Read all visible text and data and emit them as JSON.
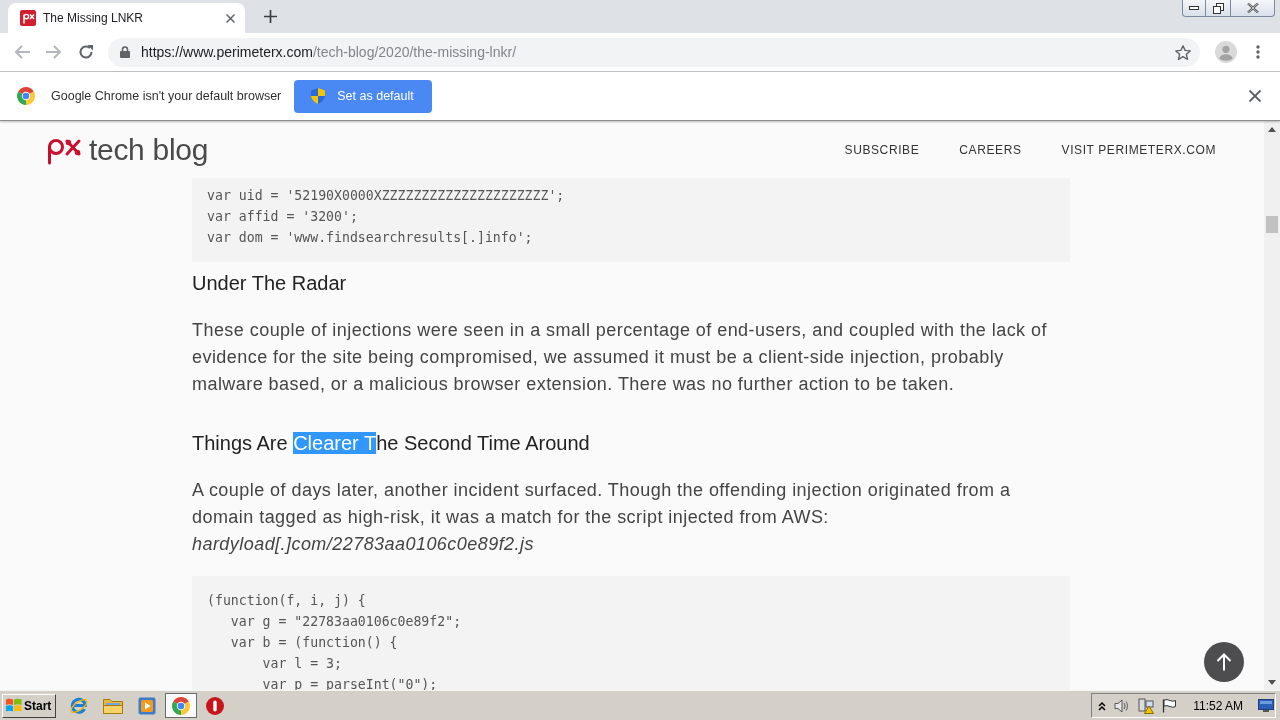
{
  "browser": {
    "tabs": [
      {
        "title": "The Missing LNKR",
        "selected": true
      }
    ],
    "address": {
      "host": "https://www.perimeterx.com",
      "path": "/tech-blog/2020/the-missing-lnkr/"
    }
  },
  "infobar": {
    "message": "Google Chrome isn't your default browser",
    "button": "Set as default"
  },
  "site": {
    "logo_text": "tech blog",
    "nav": [
      "SUBSCRIBE",
      "CAREERS",
      "VISIT PERIMETERX.COM"
    ]
  },
  "article": [
    {
      "kind": "code",
      "lines": [
        "var uid = '52190X0000XZZZZZZZZZZZZZZZZZZZZZ';",
        "var affid = '3200';",
        "var dom = 'www.findsearchresults[.]info';"
      ]
    },
    {
      "kind": "heading",
      "segments": [
        {
          "text": "Under The Radar",
          "selected": false
        }
      ]
    },
    {
      "kind": "paragraph",
      "text": "These couple of injections were seen in a small percentage of end-users, and coupled with the lack of evidence for the site being compromised, we assumed it must be a client-side injection, probably malware based, or a malicious browser extension. There was no further action to be taken."
    },
    {
      "kind": "heading",
      "segments": [
        {
          "text": "Things Are ",
          "selected": false
        },
        {
          "text": "Clearer T",
          "selected": true
        },
        {
          "text": "he Second Time Around",
          "selected": false
        }
      ]
    },
    {
      "kind": "paragraph",
      "text": "A couple of days later, another incident surfaced. Though the offending injection originated from a domain tagged as high-risk, it was a match for the script injected from AWS:\n*hardyload[.]com/22783aa0106c0e89f2.js*"
    },
    {
      "kind": "code",
      "lines": [
        "(function(f, i, j) {",
        "   var g = \"22783aa0106c0e89f2\";",
        "   var b = (function() {",
        "       var l = 3;",
        "       var p = parseInt(\"0\");"
      ]
    }
  ],
  "taskbar": {
    "start": "Start",
    "items": [
      {
        "selected": false
      },
      {
        "selected": false
      },
      {
        "selected": false
      },
      {
        "selected": true
      },
      {
        "selected": false
      }
    ],
    "clock": "11:52 AM"
  }
}
